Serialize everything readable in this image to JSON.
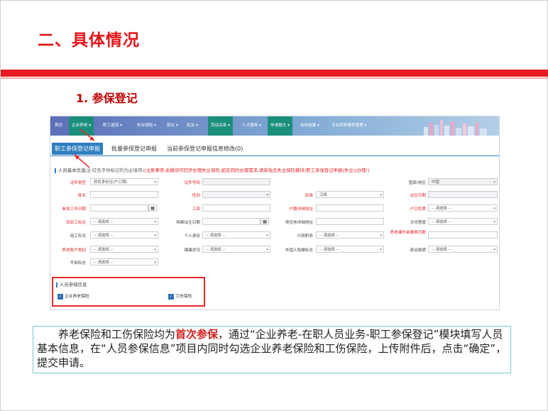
{
  "slide": {
    "title": "二、具体情况",
    "subtitle": "1. 参保登记"
  },
  "nav": {
    "items": [
      {
        "label": "首页",
        "active": false
      },
      {
        "label": "企业养老 ▾",
        "active": true
      },
      {
        "label": "职工医保 ▾",
        "active": false
      },
      {
        "label": "失业保险 ▾",
        "active": false
      },
      {
        "label": "就业 ▾",
        "active": false
      },
      {
        "label": "机关 ▾",
        "active": false
      },
      {
        "label": "劳动关系 ▾",
        "active": true
      },
      {
        "label": "人才服务 ▾",
        "active": false
      },
      {
        "label": "申请报文 ▾",
        "active": true
      },
      {
        "label": "审核结果 ▾",
        "active": false
      },
      {
        "label": "专业转移报表管理 ▾",
        "active": false
      }
    ]
  },
  "tabs": [
    {
      "label": "职工参保登记申报",
      "active": true
    },
    {
      "label": "批量参保登记申报",
      "active": false
    },
    {
      "label": "当前参保登记申报信息修改(0)",
      "active": false
    }
  ],
  "basic_info": {
    "heading": "人员基本信息",
    "hint": "(注:红色字体标记的为必填项)",
    "notice": "(注意事项:此模块可同步办理失业保险,如无同时办理需求,请单独去失业保险模块(职工参保登记申报(失业))办理!)"
  },
  "form": {
    "id_type": {
      "label": "证件类型",
      "value": "居民身份证(户口簿)"
    },
    "id_number": {
      "label": "证件号码",
      "value": ""
    },
    "country": {
      "label": "国家/地区",
      "value": "中国"
    },
    "name": {
      "label": "姓名",
      "value": ""
    },
    "gender": {
      "label": "性别",
      "value": ""
    },
    "ethnicity": {
      "label": "民族",
      "value": "汉族"
    },
    "birth_date": {
      "label": "出生日期",
      "value": ""
    },
    "work_start_date": {
      "label": "参加工作日期",
      "value": ""
    },
    "wage": {
      "label": "工资",
      "value": ""
    },
    "household_address": {
      "label": "户籍详细地址",
      "value": ""
    },
    "household_type": {
      "label": "户口性质",
      "value": "-- 请选择 --"
    },
    "migrant_flag": {
      "label": "农民工标志",
      "value": "-- 请选择 --"
    },
    "archive_birth_date": {
      "label": "档案出生日期",
      "value": ""
    },
    "residence_address": {
      "label": "常住地详细地址",
      "value": ""
    },
    "education": {
      "label": "文化程度",
      "value": "-- 请选择 --"
    },
    "employment_form": {
      "label": "用工形式",
      "value": "-- 请选择 --"
    },
    "personal_status": {
      "label": "个人身份",
      "value": "-- 请选择 --"
    },
    "admin_position": {
      "label": "行政职务",
      "value": "-- 请选择 --"
    },
    "building_months": {
      "label": "养老建外前缴费月数",
      "value": ""
    },
    "pension_account_type": {
      "label": "养老账户类别",
      "value": "-- 请选择 --"
    },
    "health_status": {
      "label": "健康状况",
      "value": "-- 请选择 --"
    },
    "foreigner_flag": {
      "label": "外国人免缴标志",
      "value": "-- 请选择 --"
    },
    "political_status": {
      "label": "政治面貌",
      "value": "-- 请选择 --"
    },
    "cadre_flag": {
      "label": "干部标志",
      "value": "-- 请选择 --"
    }
  },
  "insurance": {
    "heading": "人员参保信息",
    "options": [
      {
        "label": "企业养老保险",
        "checked": true
      },
      {
        "label": "工伤保险",
        "checked": true
      }
    ]
  },
  "caption": {
    "before": "养老保险和工伤保险均为",
    "highlight": "首次参保",
    "after": "，通过“企业养老-在职人员业务-职工参保登记”模块填写人员基本信息，在“人员参保信息”项目内同时勾选企业养老保险和工伤保险，上传附件后，点击“确定”，提交申请。"
  },
  "colors": {
    "title_red": "#e1151a",
    "nav_active": "#1c8f7c",
    "tab_active": "#2f7ec0",
    "required_red": "#e0262a",
    "highlight_box": "#e52b2b"
  }
}
